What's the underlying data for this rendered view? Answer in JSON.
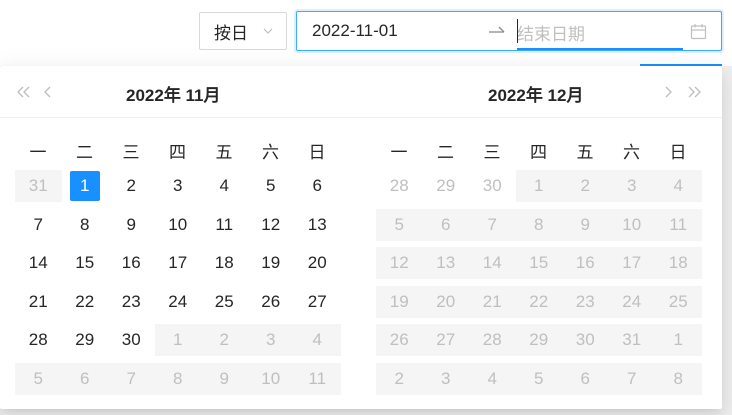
{
  "picker_mode": {
    "label": "按日"
  },
  "range": {
    "start_value": "2022-11-01",
    "end_placeholder": "结束日期"
  },
  "colors": {
    "primary": "#1890ff",
    "disabled_text": "#bfbfbf",
    "disabled_bg": "#f5f5f5"
  },
  "weekdays": [
    "一",
    "二",
    "三",
    "四",
    "五",
    "六",
    "日"
  ],
  "panels": [
    {
      "title": "2022年  11月",
      "nav": [
        "super-prev-icon",
        "prev-icon"
      ],
      "weeks": [
        [
          {
            "d": "31",
            "muted": true
          },
          {
            "d": "1",
            "selected": true
          },
          {
            "d": "2"
          },
          {
            "d": "3"
          },
          {
            "d": "4"
          },
          {
            "d": "5"
          },
          {
            "d": "6"
          }
        ],
        [
          {
            "d": "7"
          },
          {
            "d": "8"
          },
          {
            "d": "9"
          },
          {
            "d": "10"
          },
          {
            "d": "11"
          },
          {
            "d": "12"
          },
          {
            "d": "13"
          }
        ],
        [
          {
            "d": "14"
          },
          {
            "d": "15"
          },
          {
            "d": "16"
          },
          {
            "d": "17"
          },
          {
            "d": "18"
          },
          {
            "d": "19"
          },
          {
            "d": "20"
          }
        ],
        [
          {
            "d": "21"
          },
          {
            "d": "22"
          },
          {
            "d": "23"
          },
          {
            "d": "24"
          },
          {
            "d": "25"
          },
          {
            "d": "26"
          },
          {
            "d": "27"
          }
        ],
        [
          {
            "d": "28"
          },
          {
            "d": "29"
          },
          {
            "d": "30"
          },
          {
            "d": "1",
            "muted": true
          },
          {
            "d": "2",
            "muted": true
          },
          {
            "d": "3",
            "muted": true
          },
          {
            "d": "4",
            "muted": true
          }
        ],
        [
          {
            "d": "5",
            "muted": true
          },
          {
            "d": "6",
            "muted": true
          },
          {
            "d": "7",
            "muted": true
          },
          {
            "d": "8",
            "muted": true
          },
          {
            "d": "9",
            "muted": true
          },
          {
            "d": "10",
            "muted": true
          },
          {
            "d": "11",
            "muted": true
          }
        ]
      ]
    },
    {
      "title": "2022年  12月",
      "nav": [
        "next-icon",
        "super-next-icon"
      ],
      "weeks": [
        [
          {
            "d": "28",
            "muted": true,
            "nobg": true
          },
          {
            "d": "29",
            "muted": true,
            "nobg": true
          },
          {
            "d": "30",
            "muted": true,
            "nobg": true
          },
          {
            "d": "1",
            "muted": true
          },
          {
            "d": "2",
            "muted": true
          },
          {
            "d": "3",
            "muted": true
          },
          {
            "d": "4",
            "muted": true
          }
        ],
        [
          {
            "d": "5",
            "muted": true
          },
          {
            "d": "6",
            "muted": true
          },
          {
            "d": "7",
            "muted": true
          },
          {
            "d": "8",
            "muted": true
          },
          {
            "d": "9",
            "muted": true
          },
          {
            "d": "10",
            "muted": true
          },
          {
            "d": "11",
            "muted": true
          }
        ],
        [
          {
            "d": "12",
            "muted": true
          },
          {
            "d": "13",
            "muted": true
          },
          {
            "d": "14",
            "muted": true
          },
          {
            "d": "15",
            "muted": true
          },
          {
            "d": "16",
            "muted": true
          },
          {
            "d": "17",
            "muted": true
          },
          {
            "d": "18",
            "muted": true
          }
        ],
        [
          {
            "d": "19",
            "muted": true
          },
          {
            "d": "20",
            "muted": true
          },
          {
            "d": "21",
            "muted": true
          },
          {
            "d": "22",
            "muted": true
          },
          {
            "d": "23",
            "muted": true
          },
          {
            "d": "24",
            "muted": true
          },
          {
            "d": "25",
            "muted": true
          }
        ],
        [
          {
            "d": "26",
            "muted": true
          },
          {
            "d": "27",
            "muted": true
          },
          {
            "d": "28",
            "muted": true
          },
          {
            "d": "29",
            "muted": true
          },
          {
            "d": "30",
            "muted": true
          },
          {
            "d": "31",
            "muted": true
          },
          {
            "d": "1",
            "muted": true
          }
        ],
        [
          {
            "d": "2",
            "muted": true
          },
          {
            "d": "3",
            "muted": true
          },
          {
            "d": "4",
            "muted": true
          },
          {
            "d": "5",
            "muted": true
          },
          {
            "d": "6",
            "muted": true
          },
          {
            "d": "7",
            "muted": true
          },
          {
            "d": "8",
            "muted": true
          }
        ]
      ]
    }
  ]
}
